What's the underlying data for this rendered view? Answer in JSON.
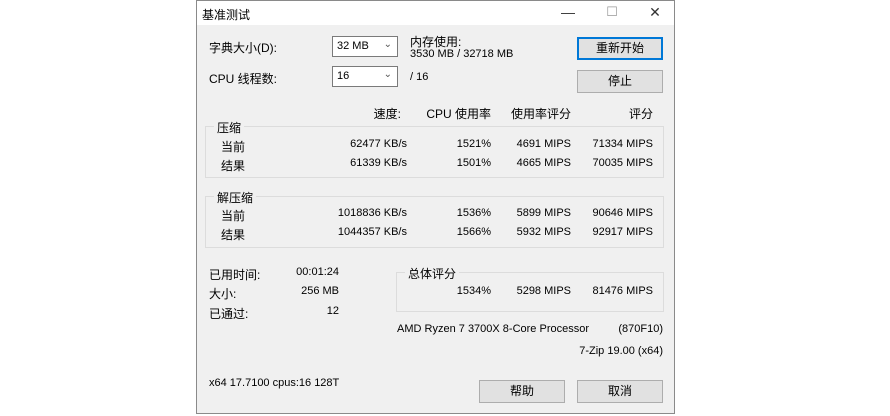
{
  "window": {
    "title": "基准测试"
  },
  "settings": {
    "dict_label": "字典大小(D):",
    "dict_value": "32 MB",
    "threads_label": "CPU 线程数:",
    "threads_value": "16",
    "threads_total": "/ 16",
    "mem_label": "内存使用:",
    "mem_value": "3530 MB / 32718 MB"
  },
  "buttons": {
    "restart": "重新开始",
    "stop": "停止",
    "help": "帮助",
    "cancel": "取消"
  },
  "headers": {
    "speed": "速度:",
    "cpu": "CPU 使用率",
    "rating_usage": "使用率评分",
    "rating": "评分"
  },
  "compress": {
    "title": "压缩",
    "rows": [
      {
        "label": "当前",
        "speed": "62477 KB/s",
        "cpu": "1521%",
        "usage": "4691 MIPS",
        "rating": "71334 MIPS"
      },
      {
        "label": "结果",
        "speed": "61339 KB/s",
        "cpu": "1501%",
        "usage": "4665 MIPS",
        "rating": "70035 MIPS"
      }
    ]
  },
  "decompress": {
    "title": "解压缩",
    "rows": [
      {
        "label": "当前",
        "speed": "1018836 KB/s",
        "cpu": "1536%",
        "usage": "5899 MIPS",
        "rating": "90646 MIPS"
      },
      {
        "label": "结果",
        "speed": "1044357 KB/s",
        "cpu": "1566%",
        "usage": "5932 MIPS",
        "rating": "92917 MIPS"
      }
    ]
  },
  "stats": {
    "elapsed_label": "已用时间:",
    "elapsed": "00:01:24",
    "size_label": "大小:",
    "size": "256 MB",
    "passes_label": "已通过:",
    "passes": "12"
  },
  "total": {
    "title": "总体评分",
    "cpu": "1534%",
    "usage": "5298 MIPS",
    "rating": "81476 MIPS"
  },
  "cpu_info": {
    "name": "AMD Ryzen 7 3700X 8-Core Processor",
    "id": "(870F10)",
    "version": "7-Zip 19.00 (x64)"
  },
  "footer": "x64 17.7100 cpus:16 128T"
}
